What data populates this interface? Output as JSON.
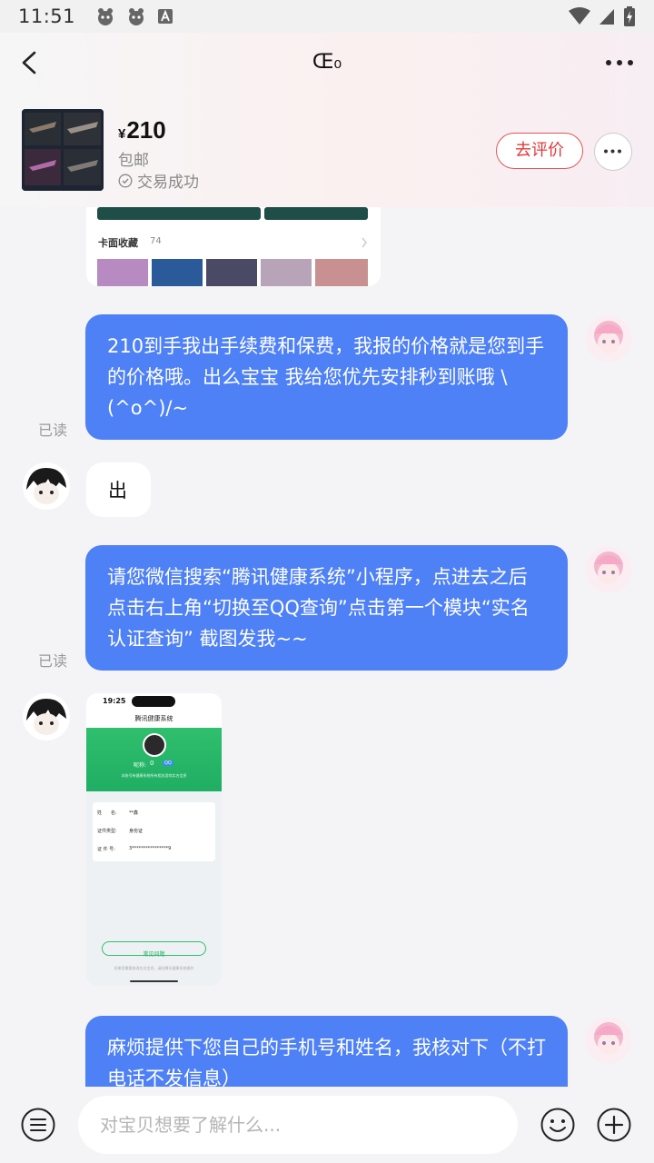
{
  "status_bar": {
    "time": "11:51"
  },
  "nav": {
    "title": "Œ₀"
  },
  "product": {
    "currency": "¥",
    "price": "210",
    "shipping": "包邮",
    "trade_status": "交易成功",
    "review_label": "去评价"
  },
  "shared_card": {
    "section_label": "卡面收藏",
    "count": "74"
  },
  "messages": [
    {
      "from": "me",
      "text": "210到手我出手续费和保费，我报的价格就是您到手的价格哦。出么宝宝 我给您优先安排秒到账哦 \\(^o^)/~",
      "read": "已读"
    },
    {
      "from": "other",
      "text": "出"
    },
    {
      "from": "me",
      "text": "请您微信搜索“腾讯健康系统”小程序，点进去之后点击右上角“切换至QQ查询”点击第一个模块“实名认证查询” 截图发我~~",
      "read": "已读"
    },
    {
      "from": "other",
      "type": "image"
    },
    {
      "from": "me",
      "text": "麻烦提供下您自己的手机号和姓名，我核对下（不打电话不发信息）"
    }
  ],
  "screenshot": {
    "time": "19:25",
    "app_title": "腾讯健康系统",
    "nickname_label": "昵称:",
    "nickname_value": "0",
    "tag": "QQ",
    "notice": "本账号有健康系统所有相关游戏实名信息",
    "name_label": "姓　　名:",
    "name_value": "**鑫",
    "id_type_label": "证件类型:",
    "id_type_value": "身份证",
    "id_no_label": "证 件 号:",
    "id_no_value": "3****************9",
    "faq_button": "常见问题",
    "footer": "如果您需要修改实名信息，请在腾讯健康系统操作"
  },
  "input": {
    "placeholder": "对宝贝想要了解什么..."
  },
  "colors": {
    "bubble_me": "#4e80f6",
    "accent_red": "#e2383b"
  }
}
